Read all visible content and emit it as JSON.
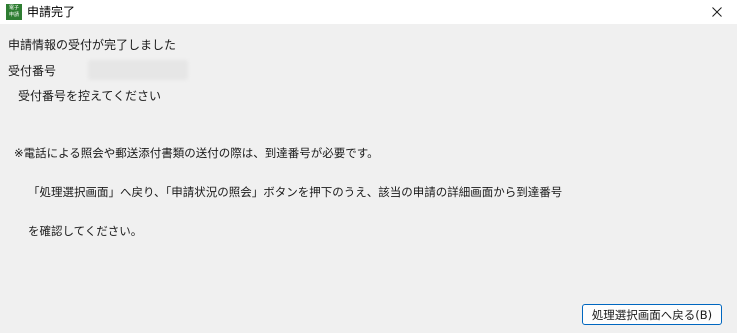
{
  "window": {
    "title": "申請完了",
    "icon": "app-logo-icon",
    "icon_text": [
      "電子",
      "申請"
    ]
  },
  "content": {
    "message": "申請情報の受付が完了しました",
    "receipt_label": "受付番号",
    "receipt_value": "",
    "instruction": "受付番号を控えてください",
    "note_lines": [
      "※電話による照会や郵送添付書類の送付の際は、到達番号が必要です。",
      "「処理選択画面」へ戻り、「申請状況の照会」ボタンを押下のうえ、該当の申請の詳細画面から到達番号",
      "を確認してください。"
    ]
  },
  "footer": {
    "back_button_label": "処理選択画面へ戻る(B)"
  },
  "colors": {
    "titlebar": "#ffffff",
    "background": "#f0f0f0",
    "button_border": "#0067c0",
    "icon_green": "#2e7d32"
  }
}
